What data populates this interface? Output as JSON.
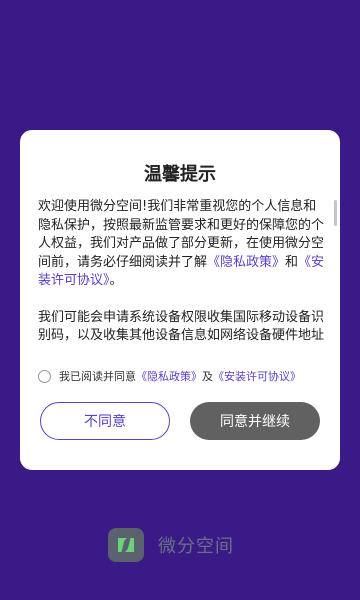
{
  "dialog": {
    "title": "温馨提示",
    "paragraph1": {
      "text": "欢迎使用微分空间!我们非常重视您的个人信息和隐私保护，按照最新监管要求和更好的保障您的个人权益，我们对产品做了部分更新，在使用微分空间前，请务必仔细阅读并了解",
      "link_privacy": "《隐私政策》",
      "and": "和",
      "link_license": "《安装许可协议》",
      "end": "。"
    },
    "paragraph2": {
      "text": "我们可能会申请系统设备权限收集国际移动设备识别码，以及收集其他设备信息如网络设备硬件地址（MAC地址）、SSID、BSSID、WiFi扫描结果、日志信息，用于识别设备，分"
    },
    "agree": {
      "prefix": "我已阅读并同意",
      "link_privacy": "《隐私政策》",
      "and": "及",
      "link_license": "《安装许可协议》"
    },
    "buttons": {
      "reject": "不同意",
      "accept": "同意并继续"
    }
  },
  "brand": {
    "name": "微分空间",
    "logo_icon": "app-logo-icon"
  },
  "colors": {
    "background": "#3a1a86",
    "accent": "#5b3fc9",
    "accept_button": "#616161"
  }
}
